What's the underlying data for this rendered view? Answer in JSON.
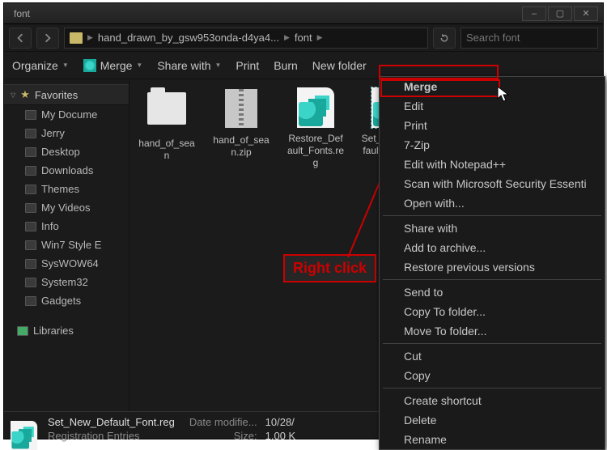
{
  "window": {
    "title": "font"
  },
  "nav": {
    "crumbs": [
      "hand_drawn_by_gsw953onda-d4ya4...",
      "font"
    ],
    "search_placeholder": "Search font"
  },
  "toolbar": {
    "organize": "Organize",
    "merge": "Merge",
    "share": "Share with",
    "print": "Print",
    "burn": "Burn",
    "newfolder": "New folder"
  },
  "sidebar": {
    "favorites_label": "Favorites",
    "items": [
      "My Docume",
      "Jerry",
      "Desktop",
      "Downloads",
      "Themes",
      "My Videos",
      "Info",
      "Win7 Style E",
      "SysWOW64",
      "System32",
      "Gadgets"
    ],
    "libraries_label": "Libraries"
  },
  "files": [
    {
      "label": "hand_of_sean",
      "type": "folder"
    },
    {
      "label": "hand_of_sean.zip",
      "type": "zip"
    },
    {
      "label": "Restore_Default_Fonts.reg",
      "type": "reg"
    },
    {
      "label": "Set_New_Default_Font.reg",
      "type": "reg",
      "selected": true
    }
  ],
  "context_menu": {
    "items": [
      {
        "label": "Merge",
        "highlight": true
      },
      {
        "label": "Edit"
      },
      {
        "label": "Print"
      },
      {
        "label": "7-Zip"
      },
      {
        "label": "Edit with Notepad++"
      },
      {
        "label": "Scan with Microsoft Security Essenti"
      },
      {
        "label": "Open with..."
      },
      {
        "sep": true
      },
      {
        "label": "Share with"
      },
      {
        "label": "Add to archive..."
      },
      {
        "label": "Restore previous versions"
      },
      {
        "sep": true
      },
      {
        "label": "Send to"
      },
      {
        "label": "Copy To folder..."
      },
      {
        "label": "Move To folder..."
      },
      {
        "sep": true
      },
      {
        "label": "Cut"
      },
      {
        "label": "Copy"
      },
      {
        "sep": true
      },
      {
        "label": "Create shortcut"
      },
      {
        "label": "Delete"
      },
      {
        "label": "Rename"
      }
    ]
  },
  "annotation": {
    "label": "Right click"
  },
  "status": {
    "filename": "Set_New_Default_Font.reg",
    "filetype": "Registration Entries",
    "modified_label": "Date modifie...",
    "modified_value": "10/28/",
    "size_label": "Size:",
    "size_value": "1.00 K"
  }
}
